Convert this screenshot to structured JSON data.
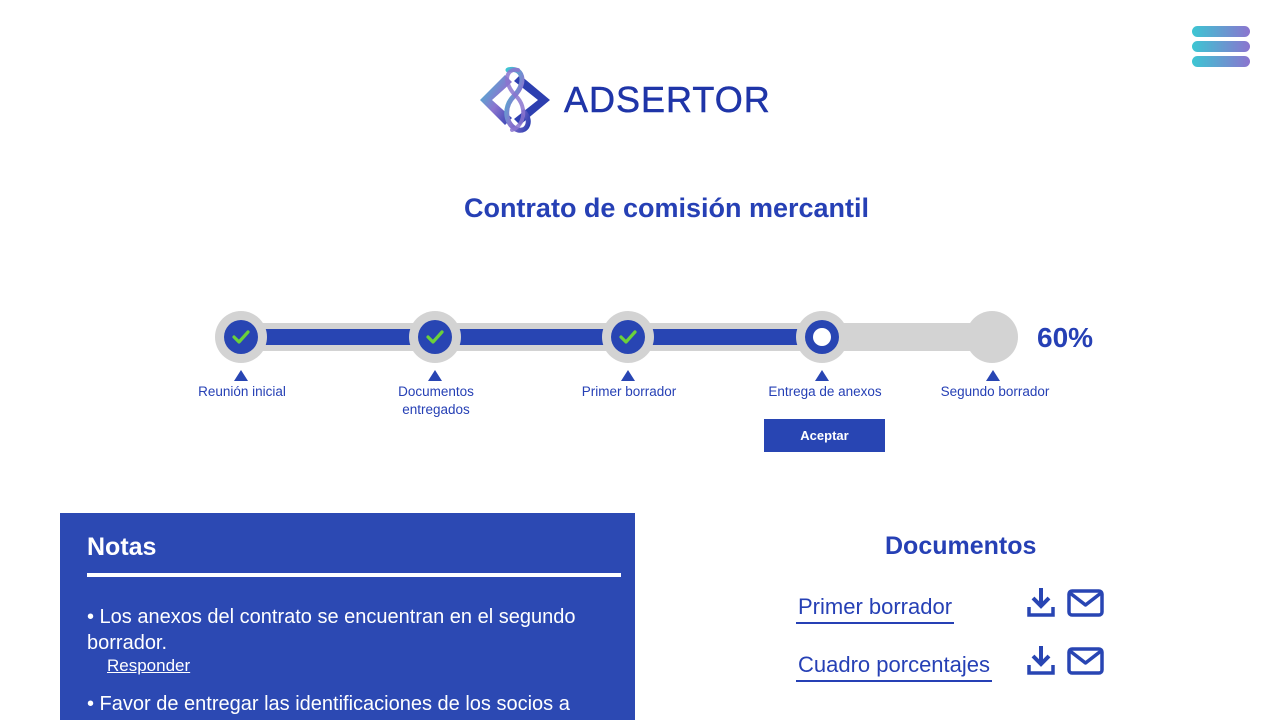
{
  "app": {
    "brand_name": "ADSERTOR",
    "menu_icon": "hamburger-menu-icon"
  },
  "header": {
    "title": "Contrato de comisión mercantil"
  },
  "progress": {
    "percent_label": "60%",
    "percent_value": 60,
    "accept_label": "Aceptar",
    "steps": [
      {
        "label": "Reunión inicial",
        "status": "done"
      },
      {
        "label": "Documentos entregados",
        "status": "done"
      },
      {
        "label": "Primer borrador",
        "status": "done"
      },
      {
        "label": "Entrega de anexos",
        "status": "current"
      },
      {
        "label": "Segundo borrador",
        "status": "pending"
      }
    ]
  },
  "notes": {
    "title": "Notas",
    "items": [
      {
        "text": "• Los anexos del contrato se encuentran en el segundo borrador.",
        "reply_label": "Responder"
      },
      {
        "text": "• Favor de entregar las identificaciones de los socios a"
      }
    ]
  },
  "documents": {
    "title": "Documentos",
    "items": [
      {
        "label": "Primer borrador",
        "download_icon": "download-icon",
        "email_icon": "email-icon"
      },
      {
        "label": "Cuadro porcentajes",
        "download_icon": "download-icon",
        "email_icon": "email-icon"
      }
    ]
  },
  "colors": {
    "primary": "#2845b3",
    "track": "#d3d3d3",
    "check": "#6bd13a",
    "menu_gradient_start": "#3cc6d2",
    "menu_gradient_end": "#8b74cf"
  }
}
